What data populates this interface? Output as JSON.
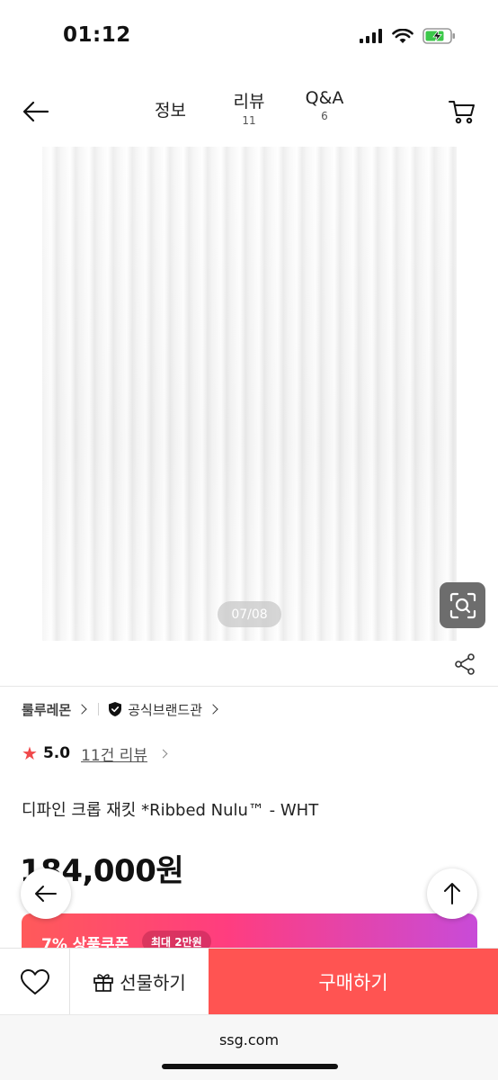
{
  "status_bar": {
    "time": "01:12"
  },
  "header": {
    "tabs": [
      {
        "label": "정보"
      },
      {
        "label": "리뷰",
        "count": "11"
      },
      {
        "label": "Q&A",
        "count": "6"
      }
    ]
  },
  "gallery": {
    "counter": "07/08"
  },
  "brand": {
    "name": "룰루레몬",
    "official_label": "공식브랜드관"
  },
  "rating": {
    "score": "5.0",
    "review_link": "11건 리뷰",
    "star": "★"
  },
  "product": {
    "name": "디파인 크롭 재킷 *Ribbed Nulu™ - WHT",
    "price": "184,000원"
  },
  "coupon": {
    "text": "7% 상품쿠폰",
    "pill": "최대 2만원"
  },
  "bottom_bar": {
    "gift_label": "선물하기",
    "buy_label": "구매하기"
  },
  "browser": {
    "url": "ssg.com"
  },
  "colors": {
    "accent": "#ff5452",
    "star": "#f0484a",
    "coupon_start": "#ff5a5a",
    "coupon_end": "#c84bd8"
  }
}
